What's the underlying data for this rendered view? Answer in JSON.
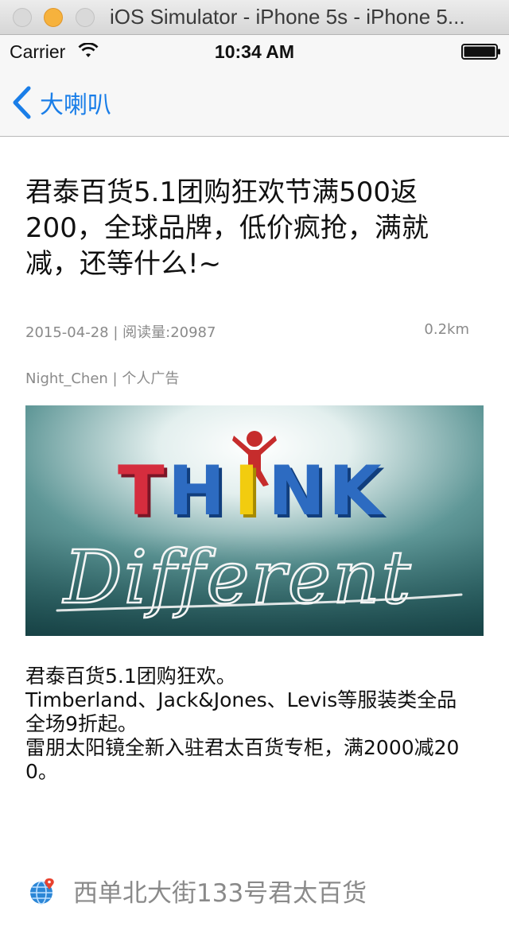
{
  "window": {
    "title": "iOS Simulator - iPhone 5s - iPhone 5..."
  },
  "status_bar": {
    "carrier": "Carrier",
    "time": "10:34 AM"
  },
  "nav": {
    "back_label": "大喇叭",
    "accent_color": "#1a7ee8"
  },
  "article": {
    "title": "君泰百货5.1团购狂欢节满500返200，全球品牌，低价疯抢，满就减，还等什么!~",
    "date": "2015-04-28",
    "views": "阅读量:20987",
    "distance": "0.2km",
    "author": "Night_Chen",
    "category": "个人广告",
    "image": {
      "line1": "THINK",
      "line2": "Different"
    },
    "body_lines": [
      "君泰百货5.1团购狂欢。",
      "Timberland、Jack&Jones、Levis等服装类全品全场9折起。",
      "雷朋太阳镜全新入驻君太百货专柜，满2000减200。"
    ],
    "location": "西单北大街133号君太百货"
  },
  "icons": [
    "wifi-icon",
    "battery-icon",
    "chevron-left-icon",
    "location-globe-icon"
  ]
}
